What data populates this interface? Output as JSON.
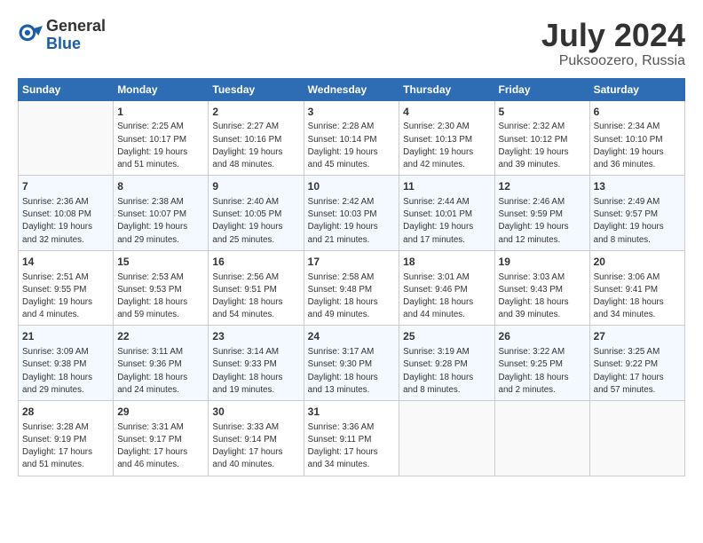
{
  "header": {
    "logo_general": "General",
    "logo_blue": "Blue",
    "month_title": "July 2024",
    "location": "Puksoozero, Russia"
  },
  "days_of_week": [
    "Sunday",
    "Monday",
    "Tuesday",
    "Wednesday",
    "Thursday",
    "Friday",
    "Saturday"
  ],
  "weeks": [
    [
      {
        "day": "",
        "info": ""
      },
      {
        "day": "1",
        "info": "Sunrise: 2:25 AM\nSunset: 10:17 PM\nDaylight: 19 hours\nand 51 minutes."
      },
      {
        "day": "2",
        "info": "Sunrise: 2:27 AM\nSunset: 10:16 PM\nDaylight: 19 hours\nand 48 minutes."
      },
      {
        "day": "3",
        "info": "Sunrise: 2:28 AM\nSunset: 10:14 PM\nDaylight: 19 hours\nand 45 minutes."
      },
      {
        "day": "4",
        "info": "Sunrise: 2:30 AM\nSunset: 10:13 PM\nDaylight: 19 hours\nand 42 minutes."
      },
      {
        "day": "5",
        "info": "Sunrise: 2:32 AM\nSunset: 10:12 PM\nDaylight: 19 hours\nand 39 minutes."
      },
      {
        "day": "6",
        "info": "Sunrise: 2:34 AM\nSunset: 10:10 PM\nDaylight: 19 hours\nand 36 minutes."
      }
    ],
    [
      {
        "day": "7",
        "info": "Sunrise: 2:36 AM\nSunset: 10:08 PM\nDaylight: 19 hours\nand 32 minutes."
      },
      {
        "day": "8",
        "info": "Sunrise: 2:38 AM\nSunset: 10:07 PM\nDaylight: 19 hours\nand 29 minutes."
      },
      {
        "day": "9",
        "info": "Sunrise: 2:40 AM\nSunset: 10:05 PM\nDaylight: 19 hours\nand 25 minutes."
      },
      {
        "day": "10",
        "info": "Sunrise: 2:42 AM\nSunset: 10:03 PM\nDaylight: 19 hours\nand 21 minutes."
      },
      {
        "day": "11",
        "info": "Sunrise: 2:44 AM\nSunset: 10:01 PM\nDaylight: 19 hours\nand 17 minutes."
      },
      {
        "day": "12",
        "info": "Sunrise: 2:46 AM\nSunset: 9:59 PM\nDaylight: 19 hours\nand 12 minutes."
      },
      {
        "day": "13",
        "info": "Sunrise: 2:49 AM\nSunset: 9:57 PM\nDaylight: 19 hours\nand 8 minutes."
      }
    ],
    [
      {
        "day": "14",
        "info": "Sunrise: 2:51 AM\nSunset: 9:55 PM\nDaylight: 19 hours\nand 4 minutes."
      },
      {
        "day": "15",
        "info": "Sunrise: 2:53 AM\nSunset: 9:53 PM\nDaylight: 18 hours\nand 59 minutes."
      },
      {
        "day": "16",
        "info": "Sunrise: 2:56 AM\nSunset: 9:51 PM\nDaylight: 18 hours\nand 54 minutes."
      },
      {
        "day": "17",
        "info": "Sunrise: 2:58 AM\nSunset: 9:48 PM\nDaylight: 18 hours\nand 49 minutes."
      },
      {
        "day": "18",
        "info": "Sunrise: 3:01 AM\nSunset: 9:46 PM\nDaylight: 18 hours\nand 44 minutes."
      },
      {
        "day": "19",
        "info": "Sunrise: 3:03 AM\nSunset: 9:43 PM\nDaylight: 18 hours\nand 39 minutes."
      },
      {
        "day": "20",
        "info": "Sunrise: 3:06 AM\nSunset: 9:41 PM\nDaylight: 18 hours\nand 34 minutes."
      }
    ],
    [
      {
        "day": "21",
        "info": "Sunrise: 3:09 AM\nSunset: 9:38 PM\nDaylight: 18 hours\nand 29 minutes."
      },
      {
        "day": "22",
        "info": "Sunrise: 3:11 AM\nSunset: 9:36 PM\nDaylight: 18 hours\nand 24 minutes."
      },
      {
        "day": "23",
        "info": "Sunrise: 3:14 AM\nSunset: 9:33 PM\nDaylight: 18 hours\nand 19 minutes."
      },
      {
        "day": "24",
        "info": "Sunrise: 3:17 AM\nSunset: 9:30 PM\nDaylight: 18 hours\nand 13 minutes."
      },
      {
        "day": "25",
        "info": "Sunrise: 3:19 AM\nSunset: 9:28 PM\nDaylight: 18 hours\nand 8 minutes."
      },
      {
        "day": "26",
        "info": "Sunrise: 3:22 AM\nSunset: 9:25 PM\nDaylight: 18 hours\nand 2 minutes."
      },
      {
        "day": "27",
        "info": "Sunrise: 3:25 AM\nSunset: 9:22 PM\nDaylight: 17 hours\nand 57 minutes."
      }
    ],
    [
      {
        "day": "28",
        "info": "Sunrise: 3:28 AM\nSunset: 9:19 PM\nDaylight: 17 hours\nand 51 minutes."
      },
      {
        "day": "29",
        "info": "Sunrise: 3:31 AM\nSunset: 9:17 PM\nDaylight: 17 hours\nand 46 minutes."
      },
      {
        "day": "30",
        "info": "Sunrise: 3:33 AM\nSunset: 9:14 PM\nDaylight: 17 hours\nand 40 minutes."
      },
      {
        "day": "31",
        "info": "Sunrise: 3:36 AM\nSunset: 9:11 PM\nDaylight: 17 hours\nand 34 minutes."
      },
      {
        "day": "",
        "info": ""
      },
      {
        "day": "",
        "info": ""
      },
      {
        "day": "",
        "info": ""
      }
    ]
  ]
}
